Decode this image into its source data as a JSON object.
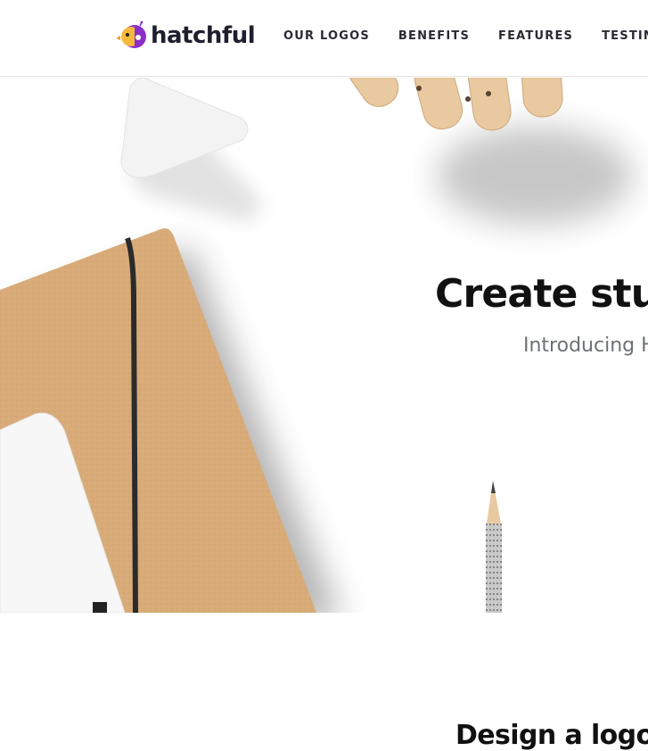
{
  "brand": {
    "name": "hatchful"
  },
  "nav": {
    "items": [
      {
        "label": "OUR LOGOS"
      },
      {
        "label": "BENEFITS"
      },
      {
        "label": "FEATURES"
      },
      {
        "label": "TESTIMON"
      }
    ]
  },
  "hero": {
    "title": "Create stun",
    "subtitle": "Introducing H"
  },
  "section2": {
    "title": "Design a logo"
  },
  "colors": {
    "brand_yellow": "#f5b83d",
    "brand_purple": "#8a2be2",
    "kraft": "#d9ad7c"
  },
  "icons": [
    "hatchful-chick-icon"
  ]
}
